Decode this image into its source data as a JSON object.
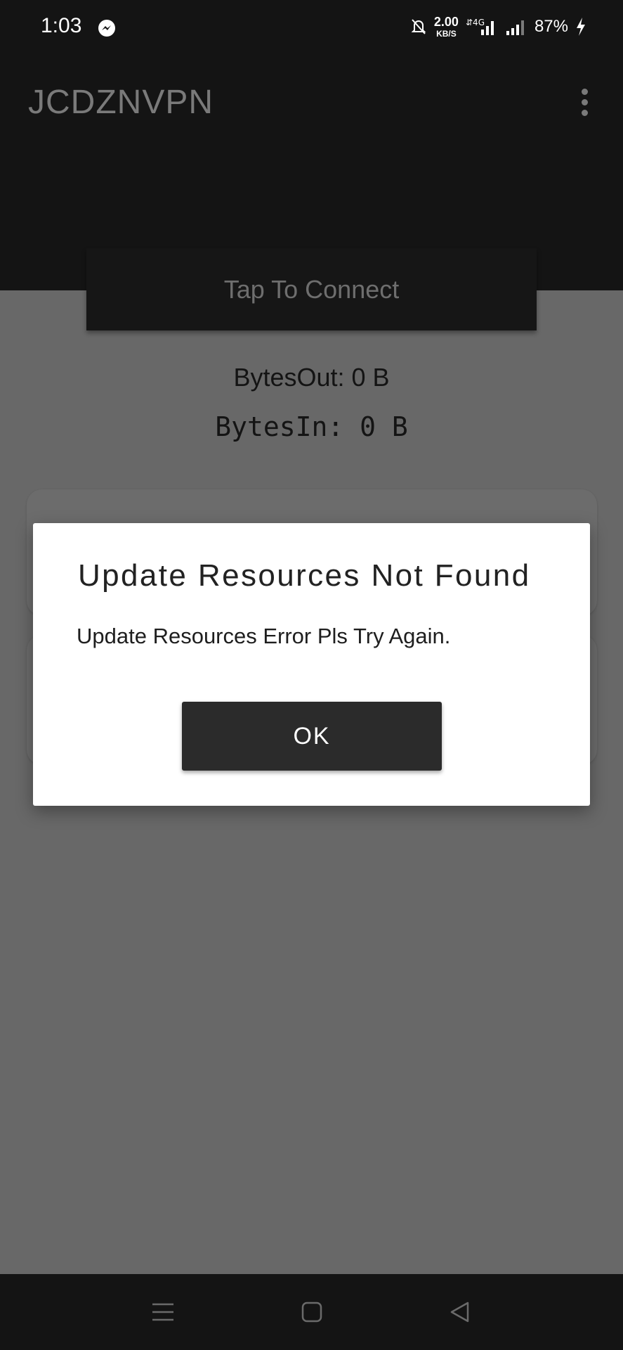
{
  "status_bar": {
    "time": "1:03",
    "net_speed_value": "2.00",
    "net_speed_unit": "KB/S",
    "network_type": "4G",
    "battery": "87%",
    "icons": [
      "messenger-icon",
      "bell-off-icon",
      "signal-4g-icon",
      "signal-icon",
      "charging-icon"
    ]
  },
  "app_bar": {
    "title": "JCDZNVPN",
    "menu_icon": "more-vert-icon"
  },
  "main": {
    "connect_label": "Tap To Connect",
    "bytes_out": "BytesOut: 0 B",
    "bytes_in": "BytesIn: 0 B"
  },
  "dialog": {
    "title": "Update Resources Not Found",
    "message": "Update Resources Error Pls Try Again.",
    "ok_label": "OK"
  },
  "nav_bar": {
    "icons": [
      "recent-apps-icon",
      "home-icon",
      "back-icon"
    ]
  },
  "colors": {
    "app_background": "#141414",
    "scrim_background": "#686868",
    "dialog_background": "#ffffff",
    "button_background": "#2b2b2b"
  }
}
